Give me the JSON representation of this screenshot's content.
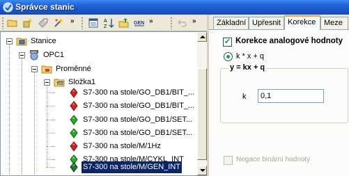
{
  "window": {
    "title": "Správce stanic"
  },
  "tree": {
    "root": {
      "label": "Stanice"
    },
    "opc": {
      "label": "OPC1"
    },
    "variables": {
      "label": "Proměnné"
    },
    "folder": {
      "label": "Složka1"
    },
    "items": [
      {
        "label": "S7-300 na stole/GO_DB1/BIT_...",
        "status": "red"
      },
      {
        "label": "S7-300 na stole/GO_DB1/BIT_...",
        "status": "red"
      },
      {
        "label": "S7-300 na stole/GO_DB1/SET...",
        "status": "green"
      },
      {
        "label": "S7-300 na stole/GO_DB1/SET...",
        "status": "green"
      },
      {
        "label": "S7-300 na stole/M/1Hz",
        "status": "red"
      },
      {
        "label": "S7-300 na stole/M/CYKL_INT",
        "status": "green"
      },
      {
        "label": "S7-300 na stole/M/GEN_INT",
        "status": "green",
        "selected": true
      }
    ],
    "badge": "OPC"
  },
  "tabs": [
    {
      "label": "Základní"
    },
    {
      "label": "Upřesnit"
    },
    {
      "label": "Korekce",
      "active": true
    },
    {
      "label": "Meze"
    }
  ],
  "korekce": {
    "enable_label": "Korekce analogové hodnoty",
    "enable_checked": true,
    "radio1_label": "k * x + q",
    "group_title": "y = kx + q",
    "k_label": "k",
    "k_value": "0,1",
    "negace_label": "Negace binární hodnoty",
    "negace_checked": false
  },
  "colors": {
    "status_red": "#d42020",
    "status_green": "#22b022",
    "selection": "#0a246a"
  }
}
